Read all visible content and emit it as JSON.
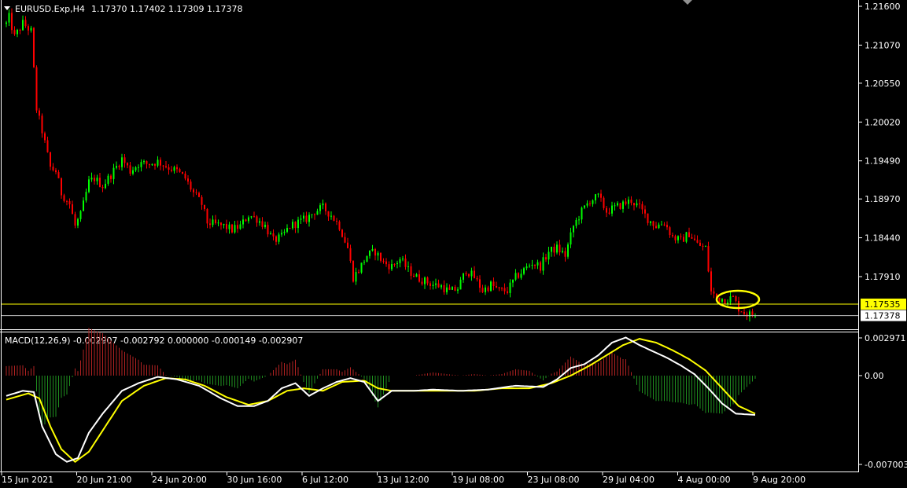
{
  "header": {
    "symbol_timeframe": "EURUSD.Exp,H4",
    "ohlc": "1.17370 1.17402 1.17309 1.17378"
  },
  "macd_header": "MACD(12,26,9) -0.002907 -0.002792 0.000000 -0.000149 -0.002907",
  "colors": {
    "background": "#000000",
    "bull": "#00ff00",
    "bear": "#ff0000",
    "macd_line": "#ffffff",
    "signal_line": "#ffff00",
    "level_line": "#ffff00",
    "bid_line": "#c0c0c0",
    "histogram_pos": "#b22222",
    "histogram_neg": "#1f8f1f"
  },
  "price_axis": {
    "ticks": [
      "1.21600",
      "1.21070",
      "1.20550",
      "1.20020",
      "1.19490",
      "1.18970",
      "1.18440",
      "1.17910"
    ],
    "level_label": "1.17535",
    "bid_label": "1.17378"
  },
  "macd_axis": {
    "ticks": [
      "0.002971",
      "0.00",
      "-0.007003"
    ]
  },
  "time_axis": {
    "labels": [
      "15 Jun 2021",
      "20 Jun 21:00",
      "24 Jun 20:00",
      "30 Jun 16:00",
      "6 Jul 12:00",
      "13 Jul 12:00",
      "19 Jul 08:00",
      "23 Jul 08:00",
      "29 Jul 04:00",
      "4 Aug 00:00",
      "9 Aug 20:00"
    ]
  },
  "chart_data": {
    "type": "candlestick",
    "symbol": "EURUSD.Exp",
    "timeframe": "H4",
    "price_range": [
      1.1732,
      1.2165
    ],
    "horizontal_level": 1.17535,
    "bid": 1.17378,
    "path_knots": [
      [
        0,
        1.2136
      ],
      [
        1,
        1.2145
      ],
      [
        3,
        1.2118
      ],
      [
        6,
        1.2137
      ],
      [
        9,
        1.2126
      ],
      [
        11,
        1.202
      ],
      [
        13,
        1.199
      ],
      [
        16,
        1.194
      ],
      [
        18,
        1.1935
      ],
      [
        20,
        1.1905
      ],
      [
        23,
        1.189
      ],
      [
        25,
        1.186
      ],
      [
        27,
        1.1875
      ],
      [
        30,
        1.192
      ],
      [
        32,
        1.1925
      ],
      [
        35,
        1.1915
      ],
      [
        38,
        1.193
      ],
      [
        42,
        1.1952
      ],
      [
        45,
        1.1935
      ],
      [
        48,
        1.1945
      ],
      [
        52,
        1.1945
      ],
      [
        55,
        1.1948
      ],
      [
        59,
        1.194
      ],
      [
        62,
        1.1935
      ],
      [
        65,
        1.1925
      ],
      [
        68,
        1.1905
      ],
      [
        71,
        1.189
      ],
      [
        73,
        1.1865
      ],
      [
        76,
        1.1862
      ],
      [
        79,
        1.186
      ],
      [
        82,
        1.1855
      ],
      [
        85,
        1.186
      ],
      [
        88,
        1.1875
      ],
      [
        91,
        1.187
      ],
      [
        94,
        1.186
      ],
      [
        97,
        1.184
      ],
      [
        100,
        1.1845
      ],
      [
        103,
        1.186
      ],
      [
        106,
        1.1865
      ],
      [
        109,
        1.187
      ],
      [
        112,
        1.188
      ],
      [
        115,
        1.1885
      ],
      [
        118,
        1.1875
      ],
      [
        121,
        1.186
      ],
      [
        124,
        1.183
      ],
      [
        126,
        1.179
      ],
      [
        128,
        1.18
      ],
      [
        131,
        1.182
      ],
      [
        134,
        1.1825
      ],
      [
        137,
        1.181
      ],
      [
        140,
        1.1805
      ],
      [
        143,
        1.1815
      ],
      [
        146,
        1.18
      ],
      [
        149,
        1.179
      ],
      [
        152,
        1.1785
      ],
      [
        155,
        1.178
      ],
      [
        158,
        1.1778
      ],
      [
        161,
        1.177
      ],
      [
        164,
        1.1775
      ],
      [
        167,
        1.18
      ],
      [
        170,
        1.179
      ],
      [
        173,
        1.1772
      ],
      [
        176,
        1.178
      ],
      [
        179,
        1.1772
      ],
      [
        182,
        1.1772
      ],
      [
        185,
        1.179
      ],
      [
        188,
        1.18
      ],
      [
        191,
        1.181
      ],
      [
        194,
        1.1805
      ],
      [
        197,
        1.1825
      ],
      [
        200,
        1.183
      ],
      [
        203,
        1.182
      ],
      [
        206,
        1.186
      ],
      [
        209,
        1.188
      ],
      [
        212,
        1.1895
      ],
      [
        215,
        1.19
      ],
      [
        218,
        1.188
      ],
      [
        221,
        1.1885
      ],
      [
        224,
        1.189
      ],
      [
        227,
        1.1895
      ],
      [
        230,
        1.1885
      ],
      [
        233,
        1.187
      ],
      [
        236,
        1.186
      ],
      [
        239,
        1.1865
      ],
      [
        242,
        1.1845
      ],
      [
        245,
        1.184
      ],
      [
        248,
        1.185
      ],
      [
        251,
        1.1835
      ],
      [
        254,
        1.183
      ],
      [
        256,
        1.177
      ],
      [
        258,
        1.1762
      ],
      [
        261,
        1.176
      ],
      [
        264,
        1.1762
      ],
      [
        266,
        1.1748
      ],
      [
        269,
        1.174
      ],
      [
        272,
        1.1738
      ]
    ],
    "macd_range": [
      -0.007003,
      0.002971
    ],
    "macd_knots": [
      [
        0,
        -0.0016
      ],
      [
        6,
        -0.0012
      ],
      [
        10,
        -0.0013
      ],
      [
        13,
        -0.004
      ],
      [
        18,
        -0.0062
      ],
      [
        22,
        -0.0068
      ],
      [
        26,
        -0.0065
      ],
      [
        30,
        -0.0045
      ],
      [
        35,
        -0.003
      ],
      [
        42,
        -0.0012
      ],
      [
        48,
        -0.0006
      ],
      [
        55,
        -0.0001
      ],
      [
        62,
        -0.0003
      ],
      [
        70,
        -0.0008
      ],
      [
        78,
        -0.0018
      ],
      [
        84,
        -0.0024
      ],
      [
        90,
        -0.0024
      ],
      [
        95,
        -0.002
      ],
      [
        100,
        -0.001
      ],
      [
        105,
        -0.0006
      ],
      [
        110,
        -0.0016
      ],
      [
        115,
        -0.001
      ],
      [
        120,
        -0.0005
      ],
      [
        125,
        -0.0002
      ],
      [
        130,
        -0.0005
      ],
      [
        135,
        -0.002
      ],
      [
        140,
        -0.0012
      ],
      [
        148,
        -0.0012
      ],
      [
        155,
        -0.0011
      ],
      [
        165,
        -0.0012
      ],
      [
        175,
        -0.0011
      ],
      [
        185,
        -0.0008
      ],
      [
        195,
        -0.0009
      ],
      [
        200,
        -0.0003
      ],
      [
        205,
        0.0006
      ],
      [
        210,
        0.0009
      ],
      [
        215,
        0.0016
      ],
      [
        220,
        0.0026
      ],
      [
        225,
        0.003
      ],
      [
        230,
        0.0024
      ],
      [
        235,
        0.0019
      ],
      [
        240,
        0.0014
      ],
      [
        245,
        0.0008
      ],
      [
        250,
        0.0001
      ],
      [
        255,
        -0.001
      ],
      [
        260,
        -0.0022
      ],
      [
        265,
        -0.003
      ],
      [
        272,
        -0.0031
      ]
    ],
    "signal_knots": [
      [
        0,
        -0.0019
      ],
      [
        8,
        -0.0014
      ],
      [
        12,
        -0.0018
      ],
      [
        16,
        -0.004
      ],
      [
        20,
        -0.0058
      ],
      [
        25,
        -0.0068
      ],
      [
        30,
        -0.006
      ],
      [
        36,
        -0.004
      ],
      [
        42,
        -0.002
      ],
      [
        50,
        -0.0008
      ],
      [
        58,
        -0.0002
      ],
      [
        65,
        -0.0003
      ],
      [
        72,
        -0.0008
      ],
      [
        80,
        -0.0017
      ],
      [
        88,
        -0.0023
      ],
      [
        95,
        -0.002
      ],
      [
        102,
        -0.0012
      ],
      [
        108,
        -0.001
      ],
      [
        115,
        -0.0012
      ],
      [
        122,
        -0.0005
      ],
      [
        130,
        -0.0004
      ],
      [
        135,
        -0.001
      ],
      [
        140,
        -0.0012
      ],
      [
        150,
        -0.0012
      ],
      [
        160,
        -0.0012
      ],
      [
        170,
        -0.0012
      ],
      [
        180,
        -0.001
      ],
      [
        190,
        -0.001
      ],
      [
        198,
        -0.0006
      ],
      [
        205,
        0.0
      ],
      [
        212,
        0.0008
      ],
      [
        218,
        0.0016
      ],
      [
        224,
        0.0024
      ],
      [
        230,
        0.0029
      ],
      [
        236,
        0.0026
      ],
      [
        242,
        0.002
      ],
      [
        248,
        0.0013
      ],
      [
        254,
        0.0004
      ],
      [
        260,
        -0.001
      ],
      [
        266,
        -0.0024
      ],
      [
        272,
        -0.003
      ]
    ]
  }
}
